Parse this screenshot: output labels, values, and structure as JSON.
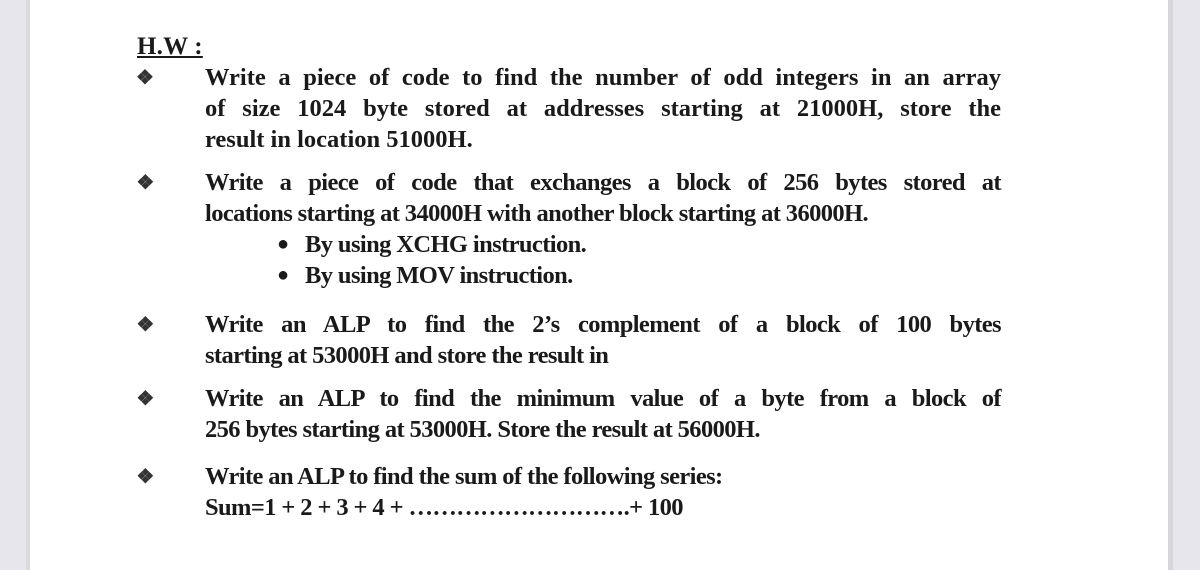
{
  "heading": "H.W :",
  "tasks": [
    {
      "bullet_icon": "diamond-bullet-icon",
      "lines": [
        "Write a piece of code to find the number of odd integers in an array",
        "of size 1024 byte stored at addresses starting at 21000H, store the",
        "result in location 51000H."
      ]
    },
    {
      "bullet_icon": "diamond-bullet-icon",
      "lines": [
        "Write a piece of code that exchanges a block of 256 bytes stored at",
        "locations starting at 34000H with another block starting at 36000H."
      ],
      "sub_items": [
        "By using XCHG instruction.",
        "By using MOV instruction."
      ]
    },
    {
      "bullet_icon": "diamond-bullet-icon",
      "lines": [
        "Write an ALP to find the  2’s complement of a block of 100 bytes",
        "starting at 53000H and store the result in"
      ]
    },
    {
      "bullet_icon": "diamond-bullet-icon",
      "lines": [
        "Write an ALP to find the minimum value of a byte from a block of",
        "256 bytes starting at 53000H. Store the result at 56000H."
      ]
    },
    {
      "bullet_icon": "diamond-bullet-icon",
      "lines": [
        "Write an ALP to find the sum of the following series:",
        "Sum=1 + 2 + 3 + 4 + ……………………….+ 100"
      ]
    }
  ]
}
